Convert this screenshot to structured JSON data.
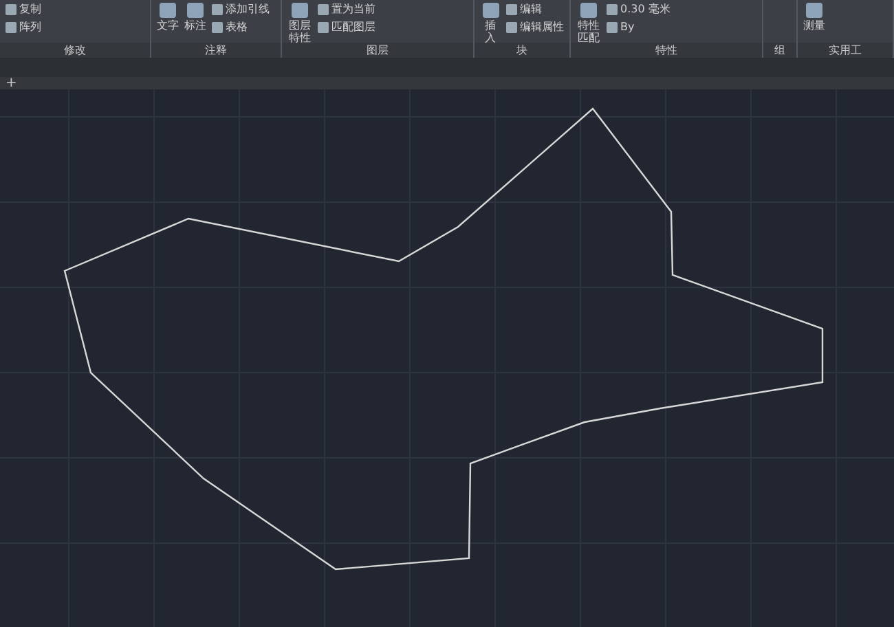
{
  "ribbon": {
    "panels": [
      {
        "title": "修改",
        "items": [
          {
            "kind": "small",
            "label": "复制"
          },
          {
            "kind": "small",
            "label": "阵列"
          }
        ]
      },
      {
        "title": "注释",
        "items": [
          {
            "kind": "large",
            "label": "文字"
          },
          {
            "kind": "large",
            "label": "标注"
          },
          {
            "kind": "small",
            "label": "添加引线"
          },
          {
            "kind": "small",
            "label": "表格"
          }
        ]
      },
      {
        "title": "图层",
        "items": [
          {
            "kind": "large",
            "label": "图层特性"
          },
          {
            "kind": "small",
            "label": "置为当前"
          },
          {
            "kind": "small",
            "label": "匹配图层"
          }
        ]
      },
      {
        "title": "块",
        "items": [
          {
            "kind": "large",
            "label": "插入"
          },
          {
            "kind": "small",
            "label": "编辑"
          },
          {
            "kind": "small",
            "label": "编辑属性"
          }
        ]
      },
      {
        "title": "特性",
        "items": [
          {
            "kind": "large",
            "label": "特性匹配"
          },
          {
            "kind": "small",
            "label": "0.30 毫米"
          },
          {
            "kind": "small",
            "label": "By"
          }
        ]
      },
      {
        "title": "组"
      },
      {
        "title": "实用工",
        "items": [
          {
            "kind": "large",
            "label": "测量"
          }
        ]
      }
    ]
  },
  "file_tabs": {
    "new_tab": "+"
  }
}
